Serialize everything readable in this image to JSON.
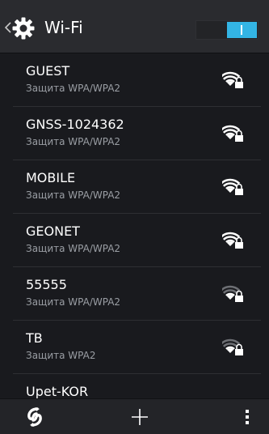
{
  "action_bar": {
    "title": "Wi-Fi",
    "app_icon": "settings-gear-icon",
    "up_icon": "chevron-left-icon",
    "wifi_switch_on": true
  },
  "colors": {
    "accent": "#33b5e5",
    "secondary_text": "#9a9ea4",
    "background": "#18191d",
    "action_bar": "#2a2b2f"
  },
  "networks": [
    {
      "ssid": "GUEST",
      "security": "Защита WPA/WPA2",
      "signal_icon": "wifi-lock-full-icon",
      "signal_level": 4
    },
    {
      "ssid": "GNSS-1024362",
      "security": "Защита WPA/WPA2",
      "signal_icon": "wifi-lock-full-icon",
      "signal_level": 4
    },
    {
      "ssid": "MOBILE",
      "security": "Защита WPA/WPA2",
      "signal_icon": "wifi-lock-full-icon",
      "signal_level": 4
    },
    {
      "ssid": "GEONET",
      "security": "Защита WPA/WPA2",
      "signal_icon": "wifi-lock-full-icon",
      "signal_level": 4
    },
    {
      "ssid": "55555",
      "security": "Защита WPA/WPA2",
      "signal_icon": "wifi-lock-medium-icon",
      "signal_level": 2
    },
    {
      "ssid": "TB",
      "security": "Защита WPA2",
      "signal_icon": "wifi-lock-medium-icon",
      "signal_level": 2
    },
    {
      "ssid": "Upet-KOR",
      "security": "",
      "signal_icon": "",
      "signal_level": 0
    }
  ],
  "bottom_bar": {
    "wps_icon": "wps-icon",
    "add_icon": "plus-icon",
    "menu_icon": "overflow-menu-icon"
  }
}
